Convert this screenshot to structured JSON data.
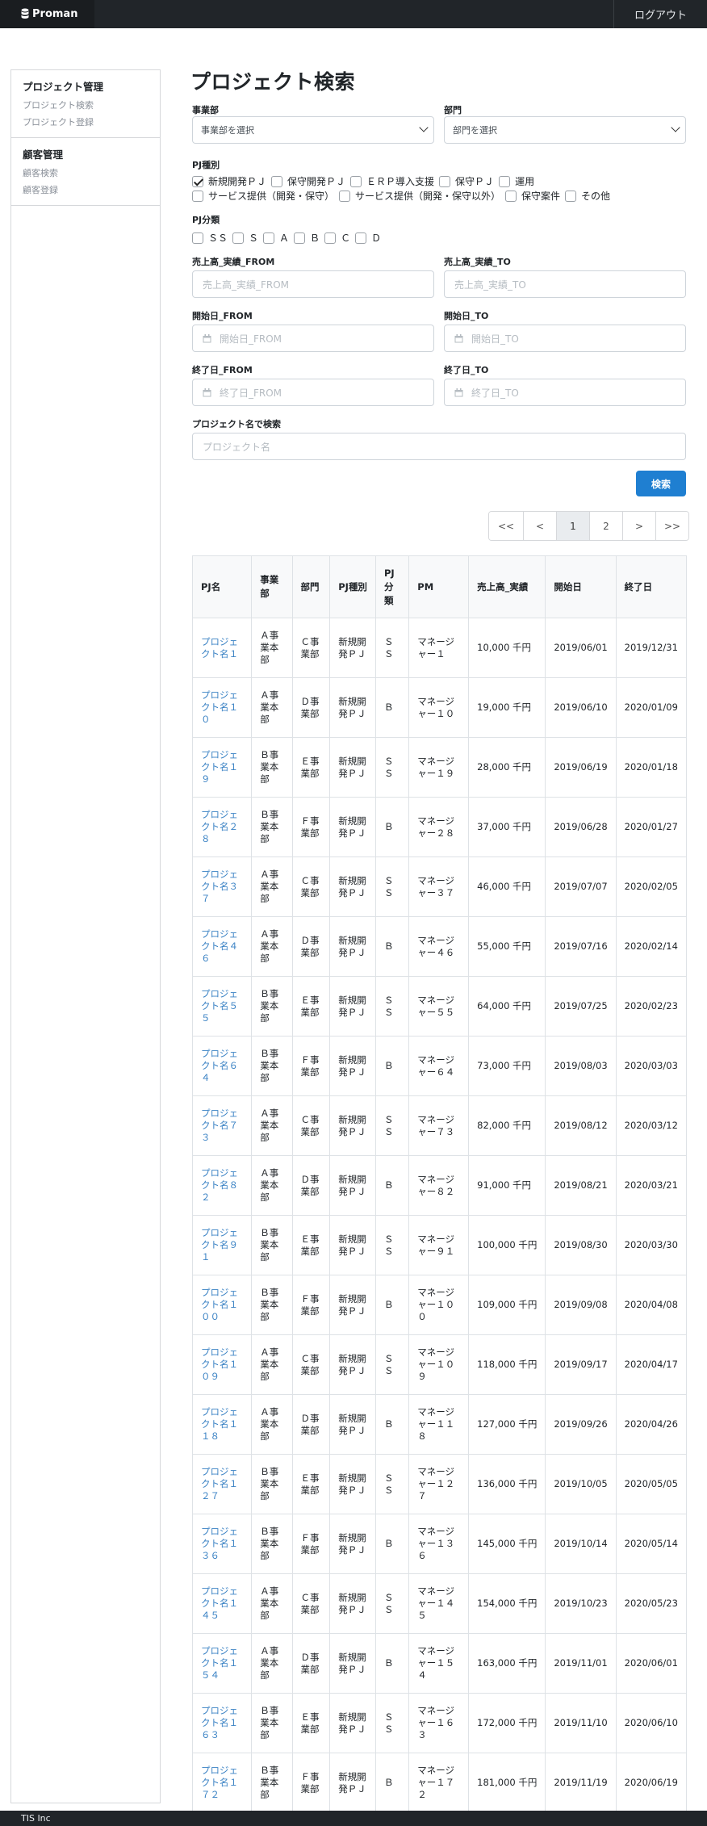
{
  "header": {
    "brand": "Proman",
    "logout": "ログアウト"
  },
  "sidebar": {
    "groups": [
      {
        "title": "プロジェクト管理",
        "links": [
          "プロジェクト検索",
          "プロジェクト登録"
        ]
      },
      {
        "title": "顧客管理",
        "links": [
          "顧客検索",
          "顧客登録"
        ]
      }
    ]
  },
  "form": {
    "title": "プロジェクト検索",
    "division_label": "事業部",
    "division_value": "事業部を選択",
    "department_label": "部門",
    "department_value": "部門を選択",
    "pj_type_label": "PJ種別",
    "pj_types": [
      {
        "label": "新規開発ＰＪ",
        "checked": true
      },
      {
        "label": "保守開発ＰＪ",
        "checked": false
      },
      {
        "label": "ＥＲＰ導入支援",
        "checked": false
      },
      {
        "label": "保守ＰＪ",
        "checked": false
      },
      {
        "label": "運用",
        "checked": false
      },
      {
        "label": "サービス提供（開発・保守）",
        "checked": false
      },
      {
        "label": "サービス提供（開発・保守以外）",
        "checked": false
      },
      {
        "label": "保守案件",
        "checked": false
      },
      {
        "label": "その他",
        "checked": false
      }
    ],
    "pj_class_label": "PJ分類",
    "pj_classes": [
      "ＳＳ",
      "Ｓ",
      "Ａ",
      "Ｂ",
      "Ｃ",
      "Ｄ"
    ],
    "sales_from_label": "売上高_実績_FROM",
    "sales_from_placeholder": "売上高_実績_FROM",
    "sales_to_label": "売上高_実績_TO",
    "sales_to_placeholder": "売上高_実績_TO",
    "start_from_label": "開始日_FROM",
    "start_from_placeholder": "開始日_FROM",
    "start_to_label": "開始日_TO",
    "start_to_placeholder": "開始日_TO",
    "end_from_label": "終了日_FROM",
    "end_from_placeholder": "終了日_FROM",
    "end_to_label": "終了日_TO",
    "end_to_placeholder": "終了日_TO",
    "name_label": "プロジェクト名で検索",
    "name_placeholder": "プロジェクト名",
    "search_button": "検索"
  },
  "pager": [
    "<<",
    "<",
    "1",
    "2",
    ">",
    ">>"
  ],
  "pager_active": "1",
  "table": {
    "headers": [
      "PJ名",
      "事業部",
      "部門",
      "PJ種別",
      "PJ分類",
      "PM",
      "売上高_実績",
      "開始日",
      "終了日"
    ],
    "rows": [
      [
        "プロジェクト名１",
        "Ａ事業本部",
        "Ｃ事業部",
        "新規開発ＰＪ",
        "ＳＳ",
        "マネージャー１",
        "10,000 千円",
        "2019/06/01",
        "2019/12/31"
      ],
      [
        "プロジェクト名１０",
        "Ａ事業本部",
        "Ｄ事業部",
        "新規開発ＰＪ",
        "Ｂ",
        "マネージャー１０",
        "19,000 千円",
        "2019/06/10",
        "2020/01/09"
      ],
      [
        "プロジェクト名１９",
        "Ｂ事業本部",
        "Ｅ事業部",
        "新規開発ＰＪ",
        "ＳＳ",
        "マネージャー１９",
        "28,000 千円",
        "2019/06/19",
        "2020/01/18"
      ],
      [
        "プロジェクト名２８",
        "Ｂ事業本部",
        "Ｆ事業部",
        "新規開発ＰＪ",
        "Ｂ",
        "マネージャー２８",
        "37,000 千円",
        "2019/06/28",
        "2020/01/27"
      ],
      [
        "プロジェクト名３７",
        "Ａ事業本部",
        "Ｃ事業部",
        "新規開発ＰＪ",
        "ＳＳ",
        "マネージャー３７",
        "46,000 千円",
        "2019/07/07",
        "2020/02/05"
      ],
      [
        "プロジェクト名４６",
        "Ａ事業本部",
        "Ｄ事業部",
        "新規開発ＰＪ",
        "Ｂ",
        "マネージャー４６",
        "55,000 千円",
        "2019/07/16",
        "2020/02/14"
      ],
      [
        "プロジェクト名５５",
        "Ｂ事業本部",
        "Ｅ事業部",
        "新規開発ＰＪ",
        "ＳＳ",
        "マネージャー５５",
        "64,000 千円",
        "2019/07/25",
        "2020/02/23"
      ],
      [
        "プロジェクト名６４",
        "Ｂ事業本部",
        "Ｆ事業部",
        "新規開発ＰＪ",
        "Ｂ",
        "マネージャー６４",
        "73,000 千円",
        "2019/08/03",
        "2020/03/03"
      ],
      [
        "プロジェクト名７３",
        "Ａ事業本部",
        "Ｃ事業部",
        "新規開発ＰＪ",
        "ＳＳ",
        "マネージャー７３",
        "82,000 千円",
        "2019/08/12",
        "2020/03/12"
      ],
      [
        "プロジェクト名８２",
        "Ａ事業本部",
        "Ｄ事業部",
        "新規開発ＰＪ",
        "Ｂ",
        "マネージャー８２",
        "91,000 千円",
        "2019/08/21",
        "2020/03/21"
      ],
      [
        "プロジェクト名９１",
        "Ｂ事業本部",
        "Ｅ事業部",
        "新規開発ＰＪ",
        "ＳＳ",
        "マネージャー９１",
        "100,000 千円",
        "2019/08/30",
        "2020/03/30"
      ],
      [
        "プロジェクト名１００",
        "Ｂ事業本部",
        "Ｆ事業部",
        "新規開発ＰＪ",
        "Ｂ",
        "マネージャー１００",
        "109,000 千円",
        "2019/09/08",
        "2020/04/08"
      ],
      [
        "プロジェクト名１０９",
        "Ａ事業本部",
        "Ｃ事業部",
        "新規開発ＰＪ",
        "ＳＳ",
        "マネージャー１０９",
        "118,000 千円",
        "2019/09/17",
        "2020/04/17"
      ],
      [
        "プロジェクト名１１８",
        "Ａ事業本部",
        "Ｄ事業部",
        "新規開発ＰＪ",
        "Ｂ",
        "マネージャー１１８",
        "127,000 千円",
        "2019/09/26",
        "2020/04/26"
      ],
      [
        "プロジェクト名１２７",
        "Ｂ事業本部",
        "Ｅ事業部",
        "新規開発ＰＪ",
        "ＳＳ",
        "マネージャー１２７",
        "136,000 千円",
        "2019/10/05",
        "2020/05/05"
      ],
      [
        "プロジェクト名１３６",
        "Ｂ事業本部",
        "Ｆ事業部",
        "新規開発ＰＪ",
        "Ｂ",
        "マネージャー１３６",
        "145,000 千円",
        "2019/10/14",
        "2020/05/14"
      ],
      [
        "プロジェクト名１４５",
        "Ａ事業本部",
        "Ｃ事業部",
        "新規開発ＰＪ",
        "ＳＳ",
        "マネージャー１４５",
        "154,000 千円",
        "2019/10/23",
        "2020/05/23"
      ],
      [
        "プロジェクト名１５４",
        "Ａ事業本部",
        "Ｄ事業部",
        "新規開発ＰＪ",
        "Ｂ",
        "マネージャー１５４",
        "163,000 千円",
        "2019/11/01",
        "2020/06/01"
      ],
      [
        "プロジェクト名１６３",
        "Ｂ事業本部",
        "Ｅ事業部",
        "新規開発ＰＪ",
        "ＳＳ",
        "マネージャー１６３",
        "172,000 千円",
        "2019/11/10",
        "2020/06/10"
      ],
      [
        "プロジェクト名１７２",
        "Ｂ事業本部",
        "Ｆ事業部",
        "新規開発ＰＪ",
        "Ｂ",
        "マネージャー１７２",
        "181,000 千円",
        "2019/11/19",
        "2020/06/19"
      ]
    ]
  },
  "footer": {
    "company": "TIS Inc"
  }
}
